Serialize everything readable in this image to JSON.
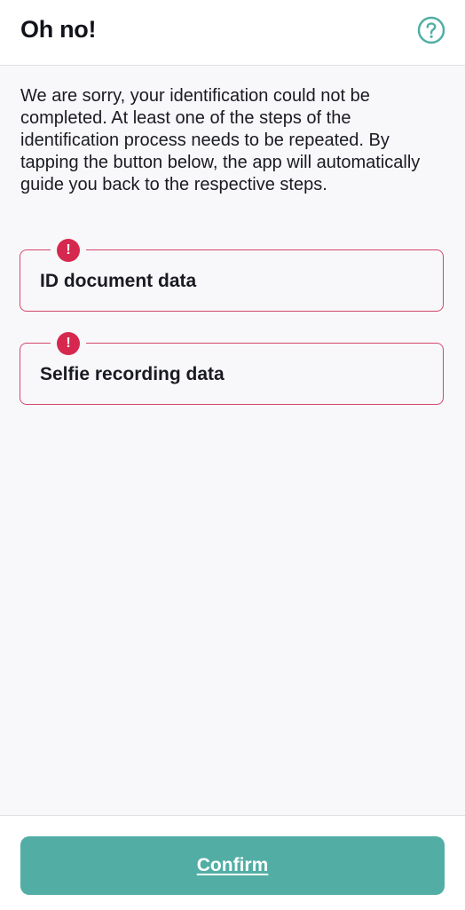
{
  "header": {
    "title": "Oh no!",
    "help_icon": "question-circle-icon"
  },
  "intro": {
    "text": "We are sorry, your identification could not be completed. At least one of the steps of the identification process needs to be repeated. By tapping the button below, the app will automatically guide you back to the respective steps."
  },
  "steps": [
    {
      "label": "ID document data",
      "icon": "alert-icon"
    },
    {
      "label": "Selfie recording data",
      "icon": "alert-icon"
    }
  ],
  "alert_glyph": "!",
  "footer": {
    "confirm_label": "Confirm"
  },
  "colors": {
    "accent": "#52aea5",
    "alert": "#d6284f",
    "card_border": "#d4476a"
  }
}
